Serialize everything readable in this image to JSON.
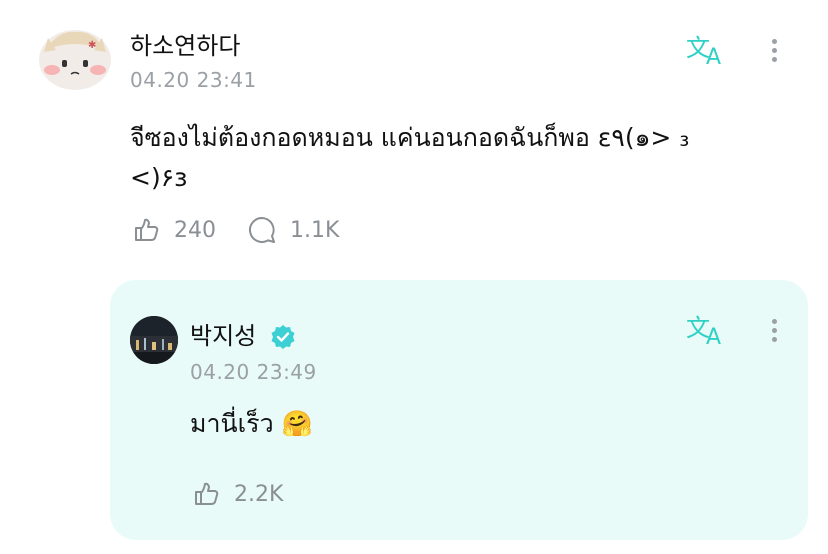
{
  "post": {
    "author": "하소연하다",
    "time": "04.20 23:41",
    "text_line1": "จีซองไม่ต้องกอดหมอน แค่นอนกอดฉันก็พอ ε٩(๑> ₃",
    "text_line2": "<)۶з",
    "likes": "240",
    "comments": "1.1K"
  },
  "reply": {
    "author": "박지성",
    "time": "04.20 23:49",
    "text": "มานี่เร็ว 🤗",
    "likes": "2.2K"
  },
  "colors": {
    "accent": "#2fd1c5",
    "reply_bg": "#e8fbf8",
    "meta_gray": "#9aa0a6",
    "verified": "#3ccfd3"
  },
  "icons": [
    "translate-icon",
    "more-vertical-icon",
    "like-icon",
    "comment-icon",
    "verified-icon"
  ]
}
